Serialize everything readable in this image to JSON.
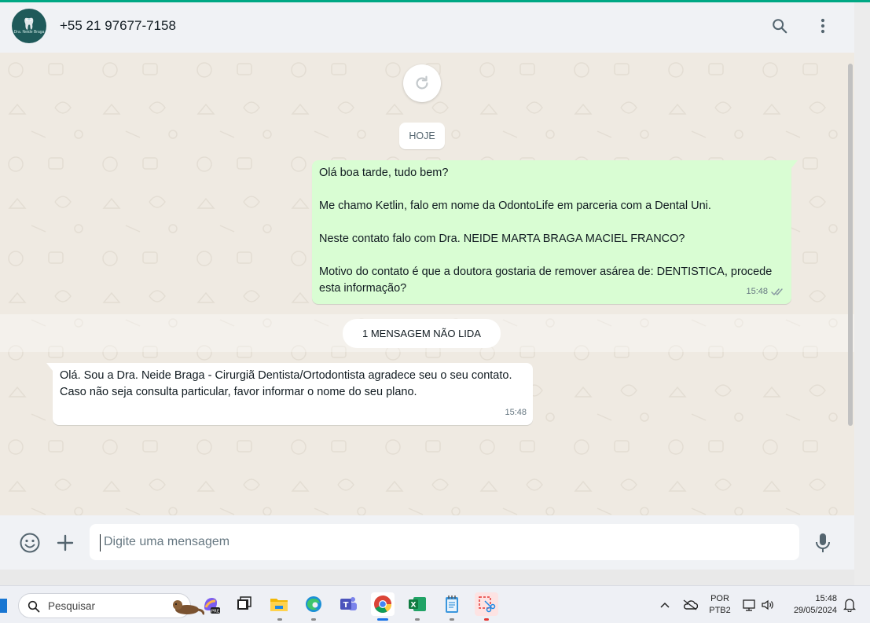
{
  "colors": {
    "accent": "#00a884",
    "outgoing_bubble": "#d9fdd3",
    "incoming_bubble": "#ffffff",
    "chat_background": "#efeae2",
    "header_background": "#f0f2f5"
  },
  "header": {
    "avatar_label": "Dra. Neide Braga",
    "contact_name": "+55 21 97677-7158",
    "icons": [
      "search-icon",
      "more-vertical-icon"
    ]
  },
  "chat": {
    "date_chip": "HOJE",
    "outgoing_message": {
      "paragraphs": [
        "Olá boa tarde, tudo bem?",
        "Me chamo Ketlin, falo em nome da OdontoLife em parceria com a Dental Uni.",
        "Neste contato falo com Dra. NEIDE MARTA BRAGA MACIEL FRANCO?",
        "Motivo do contato é que a doutora gostaria de remover asárea de: DENTISTICA, procede esta informação?"
      ],
      "time": "15:48",
      "status": "delivered"
    },
    "unread_divider": "1 MENSAGEM NÃO LIDA",
    "incoming_message": {
      "lines": [
        "Olá. Sou a Dra. Neide Braga - Cirurgiã Dentista/Ortodontista agradece seu o seu contato.",
        "Caso não seja consulta particular, favor informar o nome do seu plano."
      ],
      "time": "15:48"
    }
  },
  "composer": {
    "placeholder": "Digite uma mensagem",
    "icons": [
      "emoji-icon",
      "plus-icon",
      "microphone-icon"
    ]
  },
  "taskbar": {
    "search_label": "Pesquisar",
    "apps": [
      "copilot",
      "task-view",
      "file-explorer",
      "edge",
      "teams",
      "chrome",
      "excel",
      "notepad",
      "snipping-tool"
    ],
    "active_app": "chrome",
    "language": "POR",
    "layout": "PTB2",
    "time": "15:48",
    "date": "29/05/2024"
  }
}
